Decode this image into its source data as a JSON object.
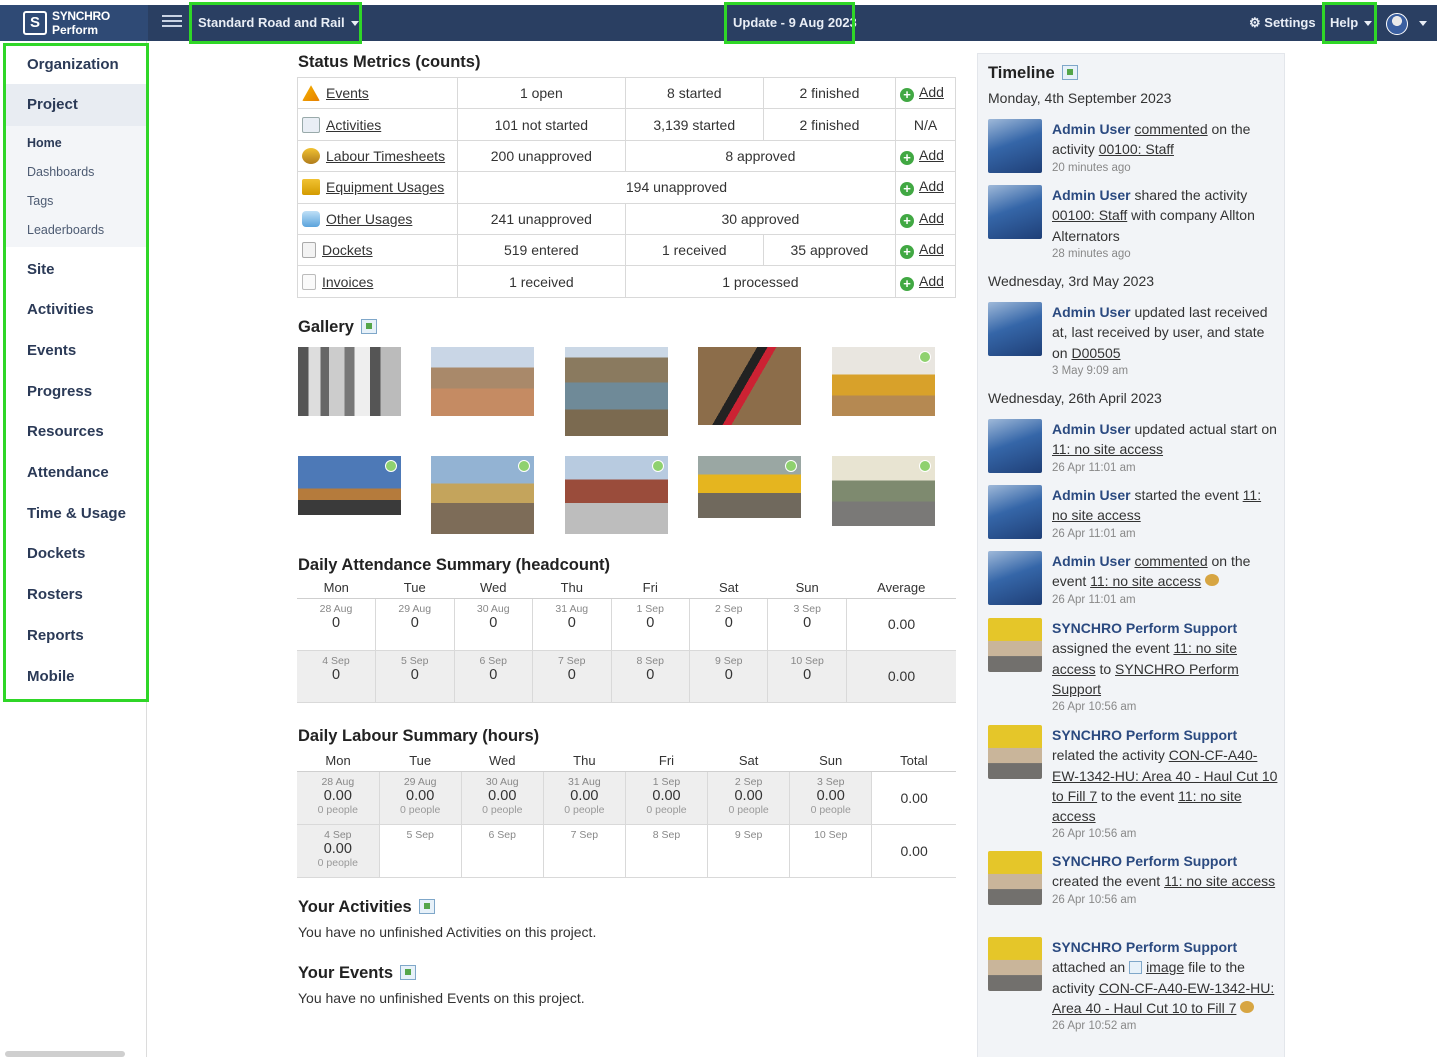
{
  "header": {
    "brand_line1": "SYNCHRO",
    "brand_line2": "Perform",
    "project_selector": "Standard Road and Rail",
    "update_label": "Update - 9 Aug 2023",
    "settings_label": "Settings",
    "help_label": "Help"
  },
  "sidebar": {
    "organization": "Organization",
    "project": "Project",
    "sub_items": [
      "Home",
      "Dashboards",
      "Tags",
      "Leaderboards"
    ],
    "items": [
      "Site",
      "Activities",
      "Events",
      "Progress",
      "Resources",
      "Attendance",
      "Time & Usage",
      "Dockets",
      "Rosters",
      "Reports",
      "Mobile"
    ]
  },
  "status": {
    "title": "Status Metrics (counts)",
    "add_label": "Add",
    "rows": [
      {
        "label": "Events",
        "c1": "1 open",
        "c2": "8 started",
        "c3": "2 finished",
        "action": "Add"
      },
      {
        "label": "Activities",
        "c1": "101 not started",
        "c2": "3,139 started",
        "c3": "2 finished",
        "action": "N/A"
      },
      {
        "label": "Labour Timesheets",
        "c1": "200 unapproved",
        "c2": "8 approved",
        "action": "Add"
      },
      {
        "label": "Equipment Usages",
        "c1": "194 unapproved",
        "action": "Add"
      },
      {
        "label": "Other Usages",
        "c1": "241 unapproved",
        "c2": "30 approved",
        "action": "Add"
      },
      {
        "label": "Dockets",
        "c1": "519 entered",
        "c2": "1 received",
        "c3": "35 approved",
        "action": "Add"
      },
      {
        "label": "Invoices",
        "c1": "1 received",
        "c2": "1 processed",
        "action": "Add"
      }
    ]
  },
  "gallery": {
    "title": "Gallery"
  },
  "attendance": {
    "title": "Daily Attendance Summary (headcount)",
    "days": [
      "Mon",
      "Tue",
      "Wed",
      "Thu",
      "Fri",
      "Sat",
      "Sun"
    ],
    "avg_label": "Average",
    "week1": [
      {
        "date": "28 Aug",
        "value": "0"
      },
      {
        "date": "29 Aug",
        "value": "0"
      },
      {
        "date": "30 Aug",
        "value": "0"
      },
      {
        "date": "31 Aug",
        "value": "0"
      },
      {
        "date": "1 Sep",
        "value": "0"
      },
      {
        "date": "2 Sep",
        "value": "0"
      },
      {
        "date": "3 Sep",
        "value": "0"
      }
    ],
    "week1_avg": "0.00",
    "week2": [
      {
        "date": "4 Sep",
        "value": "0"
      },
      {
        "date": "5 Sep",
        "value": "0"
      },
      {
        "date": "6 Sep",
        "value": "0"
      },
      {
        "date": "7 Sep",
        "value": "0"
      },
      {
        "date": "8 Sep",
        "value": "0"
      },
      {
        "date": "9 Sep",
        "value": "0"
      },
      {
        "date": "10 Sep",
        "value": "0"
      }
    ],
    "week2_avg": "0.00"
  },
  "labour": {
    "title": "Daily Labour Summary (hours)",
    "total_label": "Total",
    "week1": [
      {
        "date": "28 Aug",
        "value": "0.00",
        "people": "0 people"
      },
      {
        "date": "29 Aug",
        "value": "0.00",
        "people": "0 people"
      },
      {
        "date": "30 Aug",
        "value": "0.00",
        "people": "0 people"
      },
      {
        "date": "31 Aug",
        "value": "0.00",
        "people": "0 people"
      },
      {
        "date": "1 Sep",
        "value": "0.00",
        "people": "0 people"
      },
      {
        "date": "2 Sep",
        "value": "0.00",
        "people": "0 people"
      },
      {
        "date": "3 Sep",
        "value": "0.00",
        "people": "0 people"
      }
    ],
    "week1_total": "0.00",
    "week2": [
      {
        "date": "4 Sep",
        "value": "0.00",
        "people": "0 people"
      },
      {
        "date": "5 Sep",
        "value": "",
        "people": ""
      },
      {
        "date": "6 Sep",
        "value": "",
        "people": ""
      },
      {
        "date": "7 Sep",
        "value": "",
        "people": ""
      },
      {
        "date": "8 Sep",
        "value": "",
        "people": ""
      },
      {
        "date": "9 Sep",
        "value": "",
        "people": ""
      },
      {
        "date": "10 Sep",
        "value": "",
        "people": ""
      }
    ],
    "week2_total": "0.00"
  },
  "your_activities": {
    "title": "Your Activities",
    "text": "You have no unfinished Activities on this project."
  },
  "your_events": {
    "title": "Your Events",
    "text": "You have no unfinished Events on this project."
  },
  "timeline": {
    "title": "Timeline",
    "dates": [
      "Monday, 4th September 2023",
      "Wednesday, 3rd May 2023",
      "Wednesday, 26th April 2023"
    ],
    "entries": [
      {
        "who": "Admin User",
        "p1": "",
        "l1": "commented",
        "p2": " on the activity ",
        "l2": "00100: Staff",
        "p3": "",
        "l3": "",
        "p4": "",
        "time": "20 minutes ago"
      },
      {
        "who": "Admin User",
        "p1": " shared the activity ",
        "l1": "00100: Staff",
        "p2": " with company Allton Alternators",
        "l2": "",
        "p3": "",
        "l3": "",
        "p4": "",
        "time": "28 minutes ago"
      },
      {
        "who": "Admin User",
        "p1": " updated last received at, last received by user, and state on ",
        "l1": "D00505",
        "p2": "",
        "l2": "",
        "p3": "",
        "l3": "",
        "p4": "",
        "time": "3 May 9:09 am"
      },
      {
        "who": "Admin User",
        "p1": " updated actual start on ",
        "l1": "11: no site access",
        "p2": "",
        "l2": "",
        "p3": "",
        "l3": "",
        "p4": "",
        "time": "26 Apr 11:01 am"
      },
      {
        "who": "Admin User",
        "p1": " started the event ",
        "l1": "11: no site access",
        "p2": "",
        "l2": "",
        "p3": "",
        "l3": "",
        "p4": "",
        "time": "26 Apr 11:01 am"
      },
      {
        "who": "Admin User",
        "p1": " ",
        "l1": "commented",
        "p2": " on the event ",
        "l2": "11: no site access",
        "p3": "",
        "l3": "",
        "p4": "",
        "time": "26 Apr 11:01 am"
      },
      {
        "who": "SYNCHRO Perform Support",
        "p1": " assigned the event ",
        "l1": "11: no site access",
        "p2": " to ",
        "l2": "SYNCHRO Perform Support",
        "p3": "",
        "l3": "",
        "p4": "",
        "time": "26 Apr 10:56 am"
      },
      {
        "who": "SYNCHRO Perform Support",
        "p1": " related the activity ",
        "l1": "CON-CF-A40-EW-1342-HU: Area 40 - Haul Cut 10 to Fill 7",
        "p2": " to the event ",
        "l2": "11: no site access",
        "p3": "",
        "l3": "",
        "p4": "",
        "time": "26 Apr 10:56 am"
      },
      {
        "who": "SYNCHRO Perform Support",
        "p1": " created the event ",
        "l1": "11: no site access",
        "p2": "",
        "l2": "",
        "p3": "",
        "l3": "",
        "p4": "",
        "time": "26 Apr 10:56 am"
      },
      {
        "who": "SYNCHRO Perform Support",
        "p1": " attached an ",
        "l1": "image",
        "p2": " file to the activity ",
        "l2": "CON-CF-A40-EW-1342-HU: Area 40 - Haul Cut 10 to Fill 7",
        "p3": "",
        "l3": "",
        "p4": "",
        "time": "26 Apr 10:52 am"
      }
    ]
  },
  "colors": {
    "topbar": "#2a3f62",
    "highlight": "#2fd627",
    "link_user": "#2b4a80",
    "add_green": "#41a843"
  }
}
